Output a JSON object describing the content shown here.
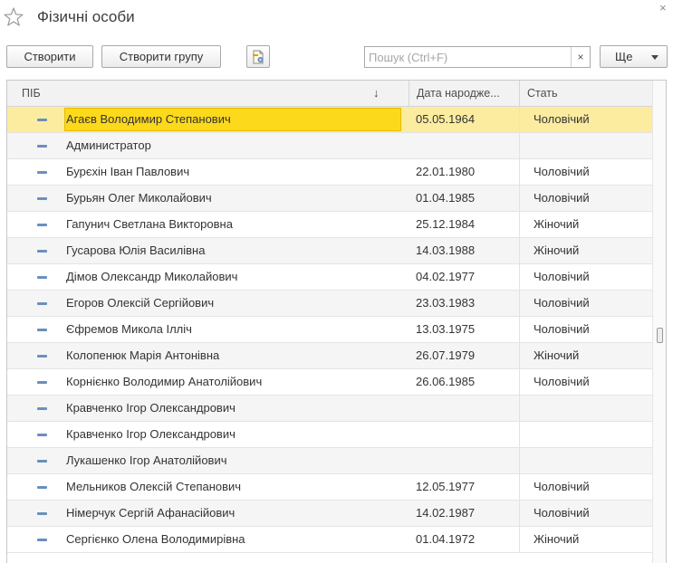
{
  "window": {
    "title": "Фізичні особи",
    "close_glyph": "×"
  },
  "toolbar": {
    "create_label": "Створити",
    "create_group_label": "Створити групу",
    "settings_icon": "document-settings-icon",
    "more_label": "Ще"
  },
  "search": {
    "placeholder": "Пошук (Ctrl+F)",
    "value": "",
    "clear_glyph": "×"
  },
  "table": {
    "columns": {
      "name": "ПІБ",
      "birth_date": "Дата народже...",
      "sex": "Стать"
    },
    "sort_indicator": "↓",
    "rows": [
      {
        "name": "Агаєв Володимир Степанович",
        "birth_date": "05.05.1964",
        "sex": "Чоловічий"
      },
      {
        "name": "Администратор",
        "birth_date": "",
        "sex": ""
      },
      {
        "name": "Бурєхін Іван Павлович",
        "birth_date": "22.01.1980",
        "sex": "Чоловічий"
      },
      {
        "name": "Бурьян Олег Миколайович",
        "birth_date": "01.04.1985",
        "sex": "Чоловічий"
      },
      {
        "name": "Гапунич Светлана Викторовна",
        "birth_date": "25.12.1984",
        "sex": "Жіночий"
      },
      {
        "name": "Гусарова Юлія Василівна",
        "birth_date": "14.03.1988",
        "sex": "Жіночий"
      },
      {
        "name": "Дімов Олександр Миколайович",
        "birth_date": "04.02.1977",
        "sex": "Чоловічий"
      },
      {
        "name": "Егоров Олексій Сергійович",
        "birth_date": "23.03.1983",
        "sex": "Чоловічий"
      },
      {
        "name": "Єфремов Микола Ілліч",
        "birth_date": "13.03.1975",
        "sex": "Чоловічий"
      },
      {
        "name": "Колопенюк Марія Антонівна",
        "birth_date": "26.07.1979",
        "sex": "Жіночий"
      },
      {
        "name": "Корнієнко Володимир Анатолійович",
        "birth_date": "26.06.1985",
        "sex": "Чоловічий"
      },
      {
        "name": "Кравченко Ігор Олександрович",
        "birth_date": "",
        "sex": ""
      },
      {
        "name": "Кравченко Ігор Олександрович",
        "birth_date": "",
        "sex": ""
      },
      {
        "name": "Лукашенко Ігор Анатолійович",
        "birth_date": "",
        "sex": ""
      },
      {
        "name": "Мельников Олексій Степанович",
        "birth_date": "12.05.1977",
        "sex": "Чоловічий"
      },
      {
        "name": "Німерчук Сергій Афанасійович",
        "birth_date": "14.02.1987",
        "sex": "Чоловічий"
      },
      {
        "name": "Сергієнко Олена Володимирівна",
        "birth_date": "01.04.1972",
        "sex": "Жіночий"
      }
    ],
    "selected_index": 0
  },
  "colors": {
    "selection_row": "#fbeca0",
    "selection_cell": "#fdd91c",
    "item_icon": "#6b8fbe"
  }
}
